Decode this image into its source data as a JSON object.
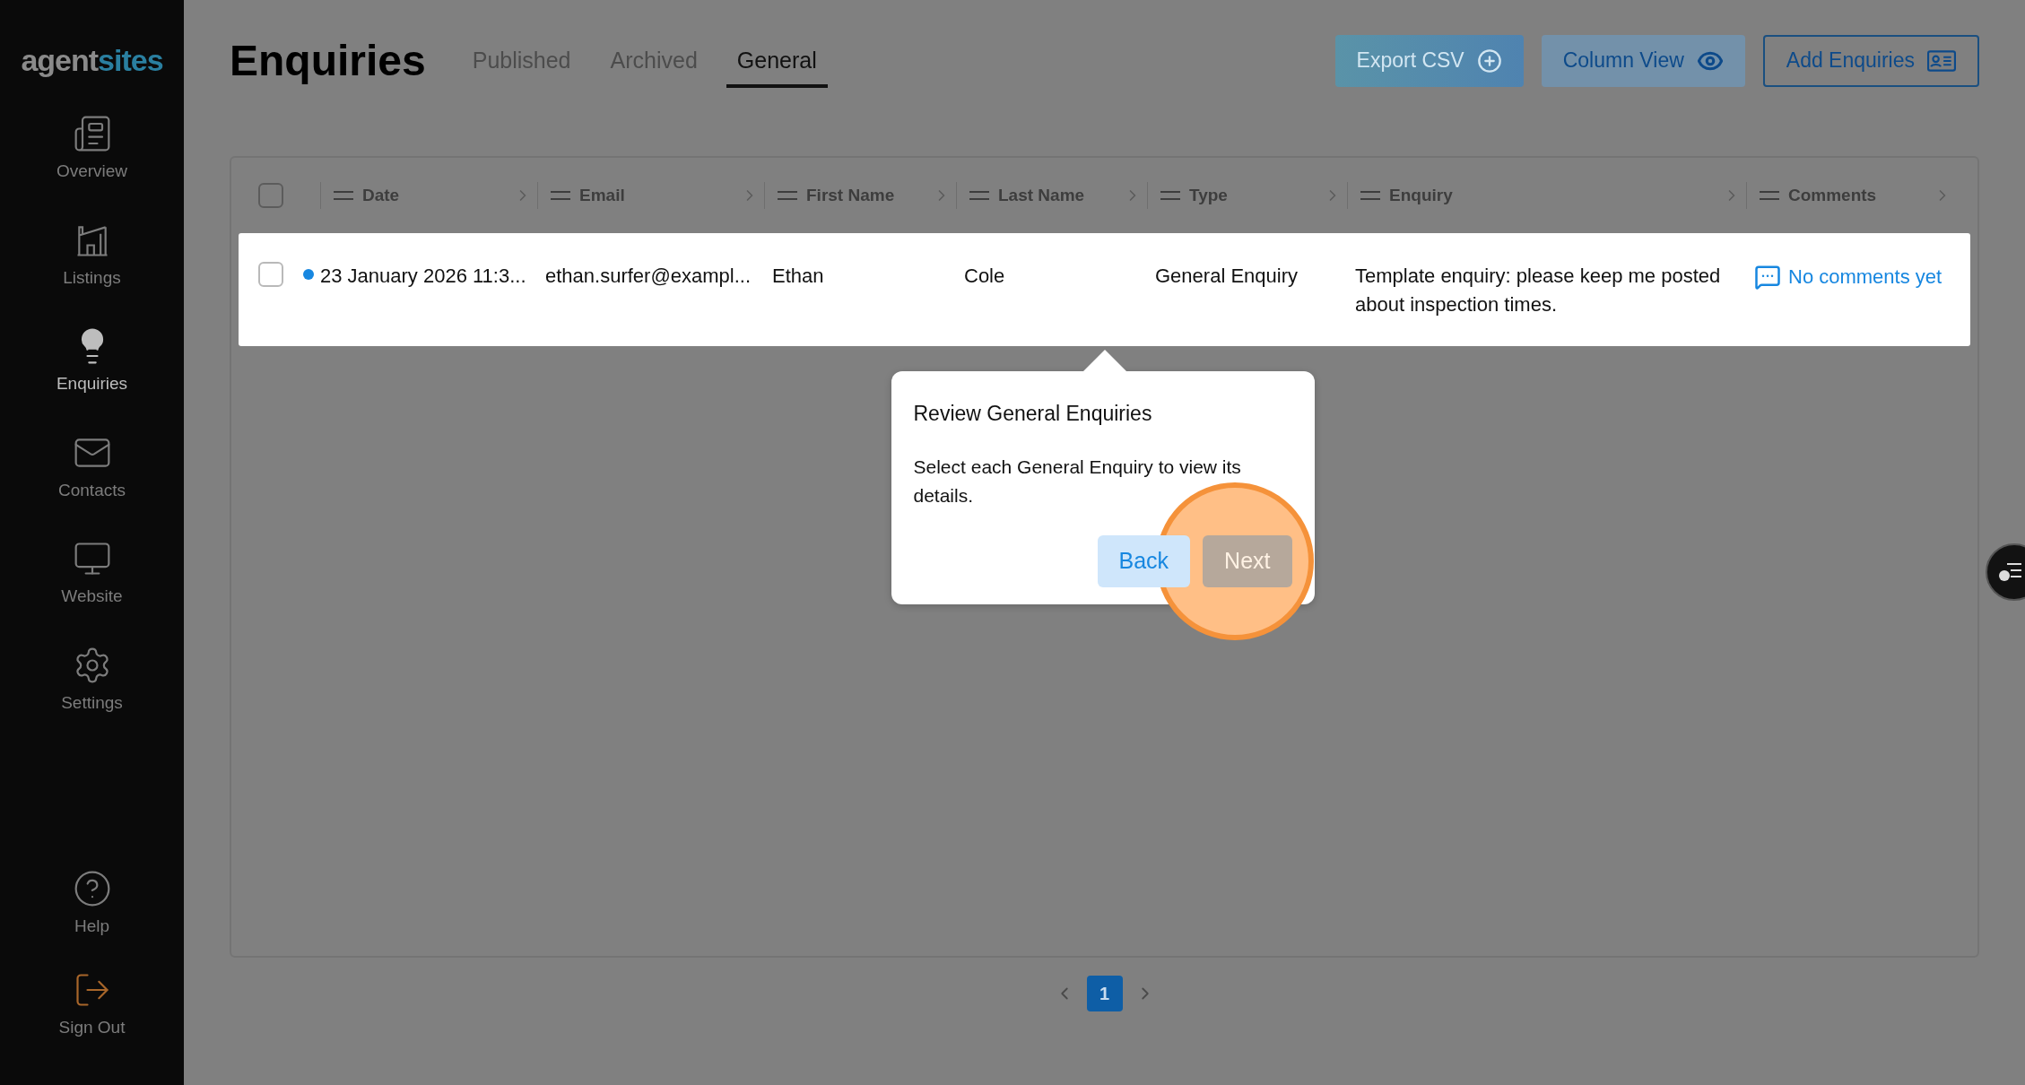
{
  "logo": {
    "first": "agent",
    "second": "sites"
  },
  "sidebar": {
    "items": [
      {
        "label": "Overview",
        "kind": "overview",
        "selected": false
      },
      {
        "label": "Listings",
        "kind": "listings",
        "selected": false
      },
      {
        "label": "Enquiries",
        "kind": "enquiries",
        "selected": true
      },
      {
        "label": "Contacts",
        "kind": "contacts",
        "selected": false
      },
      {
        "label": "Website",
        "kind": "website",
        "selected": false
      },
      {
        "label": "Settings",
        "kind": "settings",
        "selected": false
      }
    ],
    "bottom_items": [
      {
        "label": "Help",
        "kind": "help"
      },
      {
        "label": "Sign Out",
        "kind": "signout"
      }
    ]
  },
  "page_title": "Enquiries",
  "tabs": [
    {
      "label": "Published",
      "selected": false
    },
    {
      "label": "Archived",
      "selected": false
    },
    {
      "label": "General",
      "selected": true
    }
  ],
  "actions": [
    {
      "label": "Export CSV",
      "kind": "export",
      "disabled": true
    },
    {
      "label": "Column View",
      "kind": "columns",
      "disabled": false
    },
    {
      "label": "Add Enquiries",
      "kind": "add",
      "disabled": false
    }
  ],
  "table": {
    "select_all": {
      "checked": false
    },
    "columns": [
      "Date",
      "Email",
      "First Name",
      "Last Name",
      "Type",
      "Enquiry",
      "Comments"
    ],
    "rows": [
      {
        "checked": false,
        "unread": true,
        "cells": [
          "23 January 2026 11:3...",
          "ethan.surfer@exampl...",
          "Ethan",
          "Cole",
          "General Enquiry",
          "Template enquiry: please keep me posted about inspection times."
        ],
        "comments": "No comments yet"
      }
    ]
  },
  "popover": {
    "title": "Review General Enquiries",
    "body": "Select each General Enquiry to view its details.",
    "buttons": [
      {
        "label": "Back",
        "kind": "back"
      },
      {
        "label": "Next",
        "kind": "next"
      }
    ]
  },
  "pagination": {
    "pages": [
      {
        "label": "1",
        "selected": true
      }
    ]
  }
}
